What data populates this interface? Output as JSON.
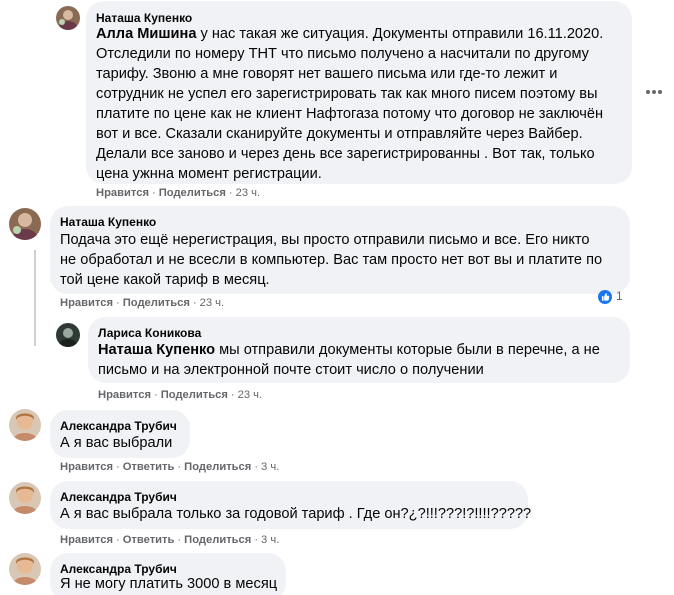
{
  "comments": [
    {
      "author": "Наташа Купенко",
      "mention": "Алла Мишина",
      "lines": [
        " у нас такая же ситуация. Документы отправили 16.11.2020.",
        "Отследили по номеру ТНТ что письмо получено а насчитали по другому",
        "тарифу. Звоню а мне говорят нет вашего письма или где-то лежит и",
        "сотрудник не успел его зарегистрировать так как много писем поэтому вы",
        "платите по цене как не клиент Нафтогаза потому что договор не заключён",
        "вот и все. Сказали сканируйте документы и отправляйте через Вайбер.",
        "Делали все заново и через день все зарегистрированны . Вот так, только",
        "цена ужнна момент регистрации."
      ],
      "like": "Нравится",
      "share": "Поделиться",
      "time": "23 ч."
    },
    {
      "author": "Наташа Купенко",
      "lines": [
        "Подача это ещё нерегистрация, вы просто отправили письмо и все. Его никто",
        "не обработал и не всесли в компьютер. Вас там просто нет вот вы и платите по",
        "той цене какой тариф в месяц."
      ],
      "like": "Нравится",
      "share": "Поделиться",
      "time": "23 ч.",
      "reactions": "1"
    },
    {
      "author": "Лариса Коникова",
      "mention": "Наташа Купенко",
      "lines": [
        " мы отправили документы которые были в перечне, а не",
        "письмо и на электронной почте стоит число о получении"
      ],
      "like": "Нравится",
      "share": "Поделиться",
      "time": "23 ч."
    },
    {
      "author": "Александра Трубич",
      "lines": [
        "А я вас выбрали"
      ],
      "like": "Нравится",
      "reply": "Ответить",
      "share": "Поделиться",
      "time": "3 ч."
    },
    {
      "author": "Александра Трубич",
      "lines": [
        "А я вас выбрала только за годовой тариф . Где он?¿?!!!???!?!!!!?????"
      ],
      "like": "Нравится",
      "reply": "Ответить",
      "share": "Поделиться",
      "time": "3 ч."
    },
    {
      "author": "Александра Трубич",
      "lines": [
        "Я не могу платить 3000 в месяц"
      ]
    }
  ],
  "colors": {
    "bubble": "#f0f2f5",
    "meta": "#65676b",
    "like_blue": "#1877f2"
  },
  "icons": {
    "more": "more-horizontal-icon",
    "like": "like-reaction-icon"
  }
}
